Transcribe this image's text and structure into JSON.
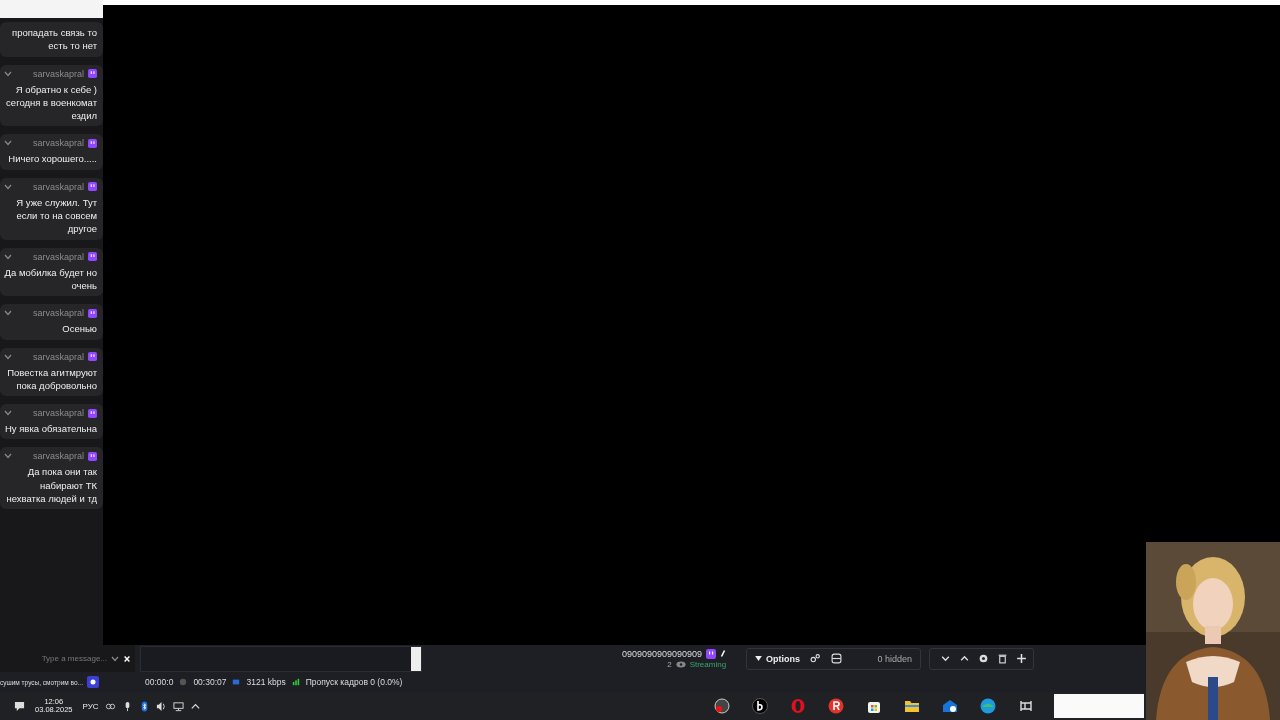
{
  "chat": {
    "first_message_tail": "пропадать связь то есть то нет",
    "messages": [
      {
        "user": "sarvaskapral",
        "text": "Я обратно к себе ) сегодня в военкомат ездил"
      },
      {
        "user": "sarvaskapral",
        "text": "Ничего хорошего....."
      },
      {
        "user": "sarvaskapral",
        "text": "Я уже служил. Тут если то на совсем другое"
      },
      {
        "user": "sarvaskapral",
        "text": "Да мобилка будет но очень"
      },
      {
        "user": "sarvaskapral",
        "text": "Осенью"
      },
      {
        "user": "sarvaskapral",
        "text": "Повестка агитмруют пока добровольно"
      },
      {
        "user": "sarvaskapral",
        "text": "Ну явка обязательна"
      },
      {
        "user": "sarvaskapral",
        "text": "Да пока они так набирают ТК нехватка людей и тд"
      }
    ],
    "input": {
      "placeholder": "Type a message..."
    },
    "ticker": "сушим трусы, смотрим во..."
  },
  "stream": {
    "title": "0909090909090909",
    "state": "Streaming",
    "viewers": "2"
  },
  "sources": {
    "options": "Options",
    "hidden": "0 hidden"
  },
  "status_bar": {
    "dropped": "Пропуск кадров 0 (0.0%)",
    "bitrate": "3121 kbps",
    "stream_time": "00:30:07",
    "record_time": "00:00:0"
  },
  "taskbar": {
    "language": "РУС",
    "time": "12:06",
    "date": "03.08.2025"
  }
}
